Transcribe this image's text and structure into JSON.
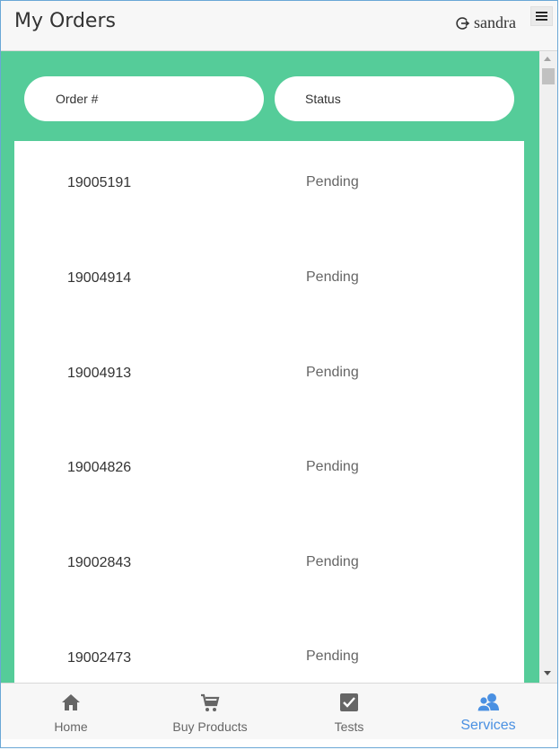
{
  "header": {
    "title": "My Orders",
    "user_name": "sandra"
  },
  "columns": {
    "order": "Order #",
    "status": "Status"
  },
  "orders": [
    {
      "number": "19005191",
      "status": "Pending"
    },
    {
      "number": "19004914",
      "status": "Pending"
    },
    {
      "number": "19004913",
      "status": "Pending"
    },
    {
      "number": "19004826",
      "status": "Pending"
    },
    {
      "number": "19002843",
      "status": "Pending"
    },
    {
      "number": "19002473",
      "status": "Pending"
    }
  ],
  "nav": [
    {
      "label": "Home",
      "icon": "home-icon"
    },
    {
      "label": "Buy Products",
      "icon": "cart-icon"
    },
    {
      "label": "Tests",
      "icon": "checkbox-icon"
    },
    {
      "label": "Services",
      "icon": "people-icon"
    }
  ],
  "colors": {
    "content_bg": "#55cc99",
    "active_nav": "#4a90e2"
  }
}
